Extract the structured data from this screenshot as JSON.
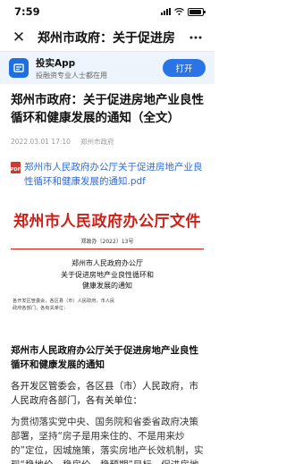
{
  "status_bar": {
    "time": "7:59",
    "location_arrow": "location-arrow-icon",
    "battery_level": 0.9
  },
  "nav": {
    "title": "郑州市政府：关于促进房",
    "close_icon": "close-icon",
    "more_icon": "more-dots-icon"
  },
  "app_banner": {
    "name": "投实App",
    "slogan": "投融资专业人士都在用",
    "open_label": "打开",
    "accent": "#2a74e6"
  },
  "article": {
    "title": "郑州市政府：关于促进房地产业良性循环和健康发展的通知（全文）",
    "date": "2022.03.01 17:10",
    "source": "郑州市政府",
    "attachment_badge": "PDF",
    "attachment_link": "郑州市人民政府办公厅关于促进房地产业良性循环和健康发展的通知.pdf"
  },
  "document_image": {
    "header": "郑州市人民政府办公厅文件",
    "number": "郑政办〔2022〕13号",
    "title_lines": [
      "郑州市人民政府办公厅",
      "关于促进房地产业良性循环和",
      "健康发展的通知"
    ],
    "recipients_lines": [
      "各开发区管委会，各区县（市）人民政府，市人民",
      "政府各部门，各有关单位："
    ]
  },
  "body": {
    "heading": "郑州市人民政府办公厅关于促进房地产业良性循环和健康发展的通知",
    "paragraph1": "各开发区管委会，各区县（市）人民政府，市人民政府各部门，各有关单位：",
    "paragraph2": "为贯彻落实党中央、国务院和省委省政府决策部署，坚持“房子是用来住的、不是用来炒的”定位，因城施策，落实房地产长效机制，实现“稳地价、稳房价、稳预期”目标，促进房地产业良性循环"
  }
}
